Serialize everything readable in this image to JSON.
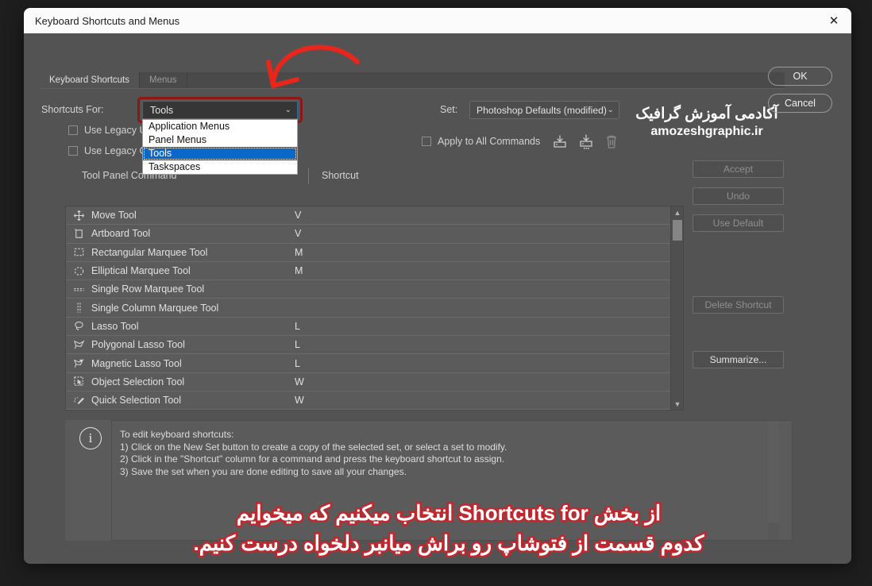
{
  "window": {
    "title": "Keyboard Shortcuts and Menus",
    "close_icon": "close-icon"
  },
  "tabs": [
    {
      "label": "Keyboard Shortcuts",
      "active": true
    },
    {
      "label": "Menus",
      "active": false
    }
  ],
  "shortcuts_for": {
    "label": "Shortcuts For:",
    "value": "Tools",
    "chevron": "⌄",
    "options": [
      "Application Menus",
      "Panel Menus",
      "Tools",
      "Taskspaces"
    ],
    "selected_option": "Tools",
    "highlight_color": "#8d1616"
  },
  "legacy_options": [
    {
      "label": "Use Legacy U",
      "checked": false
    },
    {
      "label": "Use Legacy C",
      "checked": false
    }
  ],
  "set": {
    "label": "Set:",
    "value": "Photoshop Defaults (modified)",
    "chevron": "⌄",
    "apply_all_label": "Apply to All Commands",
    "apply_all_checked": false,
    "icons": [
      "save-set-icon",
      "save-new-set-icon",
      "delete-set-icon"
    ]
  },
  "watermark": {
    "persian": "آکادمی آموزش گرافیک",
    "site": "amozeshgraphic.ir"
  },
  "table": {
    "headers": {
      "command": "Tool Panel Command",
      "shortcut": "Shortcut"
    },
    "rows": [
      {
        "icon": "move-tool-icon",
        "name": "Move Tool",
        "shortcut": "V"
      },
      {
        "icon": "artboard-tool-icon",
        "name": "Artboard Tool",
        "shortcut": "V"
      },
      {
        "icon": "rectangular-marquee-icon",
        "name": "Rectangular Marquee Tool",
        "shortcut": "M"
      },
      {
        "icon": "elliptical-marquee-icon",
        "name": "Elliptical Marquee Tool",
        "shortcut": "M"
      },
      {
        "icon": "single-row-marquee-icon",
        "name": "Single Row Marquee Tool",
        "shortcut": ""
      },
      {
        "icon": "single-column-marquee-icon",
        "name": "Single Column Marquee Tool",
        "shortcut": ""
      },
      {
        "icon": "lasso-tool-icon",
        "name": "Lasso Tool",
        "shortcut": "L"
      },
      {
        "icon": "polygonal-lasso-icon",
        "name": "Polygonal Lasso Tool",
        "shortcut": "L"
      },
      {
        "icon": "magnetic-lasso-icon",
        "name": "Magnetic Lasso Tool",
        "shortcut": "L"
      },
      {
        "icon": "object-selection-icon",
        "name": "Object Selection Tool",
        "shortcut": "W"
      },
      {
        "icon": "quick-selection-icon",
        "name": "Quick Selection Tool",
        "shortcut": "W"
      }
    ]
  },
  "side_buttons": [
    {
      "label": "Accept",
      "enabled": false
    },
    {
      "label": "Undo",
      "enabled": false
    },
    {
      "label": "Use Default",
      "enabled": false
    },
    {
      "label": "Delete Shortcut",
      "enabled": false
    },
    {
      "label": "Summarize...",
      "enabled": true
    }
  ],
  "dialog_buttons": {
    "ok": "OK",
    "cancel": "Cancel"
  },
  "info": {
    "icon": "info-icon",
    "lines": [
      "To edit keyboard shortcuts:",
      "1) Click on the New Set button to create a copy of the selected set, or select a set to modify.",
      "2) Click in the \"Shortcut\" column for a command and press the keyboard shortcut to assign.",
      "3) Save the set when you are done editing to save all your changes."
    ]
  },
  "annotation": {
    "line1_prefix": "از بخش ",
    "line1_en": "Shortcuts for",
    "line1_suffix": " انتخاب میکنیم که میخوایم",
    "line2": "کدوم قسمت از فتوشاپ رو براش میانبر دلخواه درست کنیم.",
    "color": "#c1272d",
    "arrow": "red-curved-arrow"
  }
}
